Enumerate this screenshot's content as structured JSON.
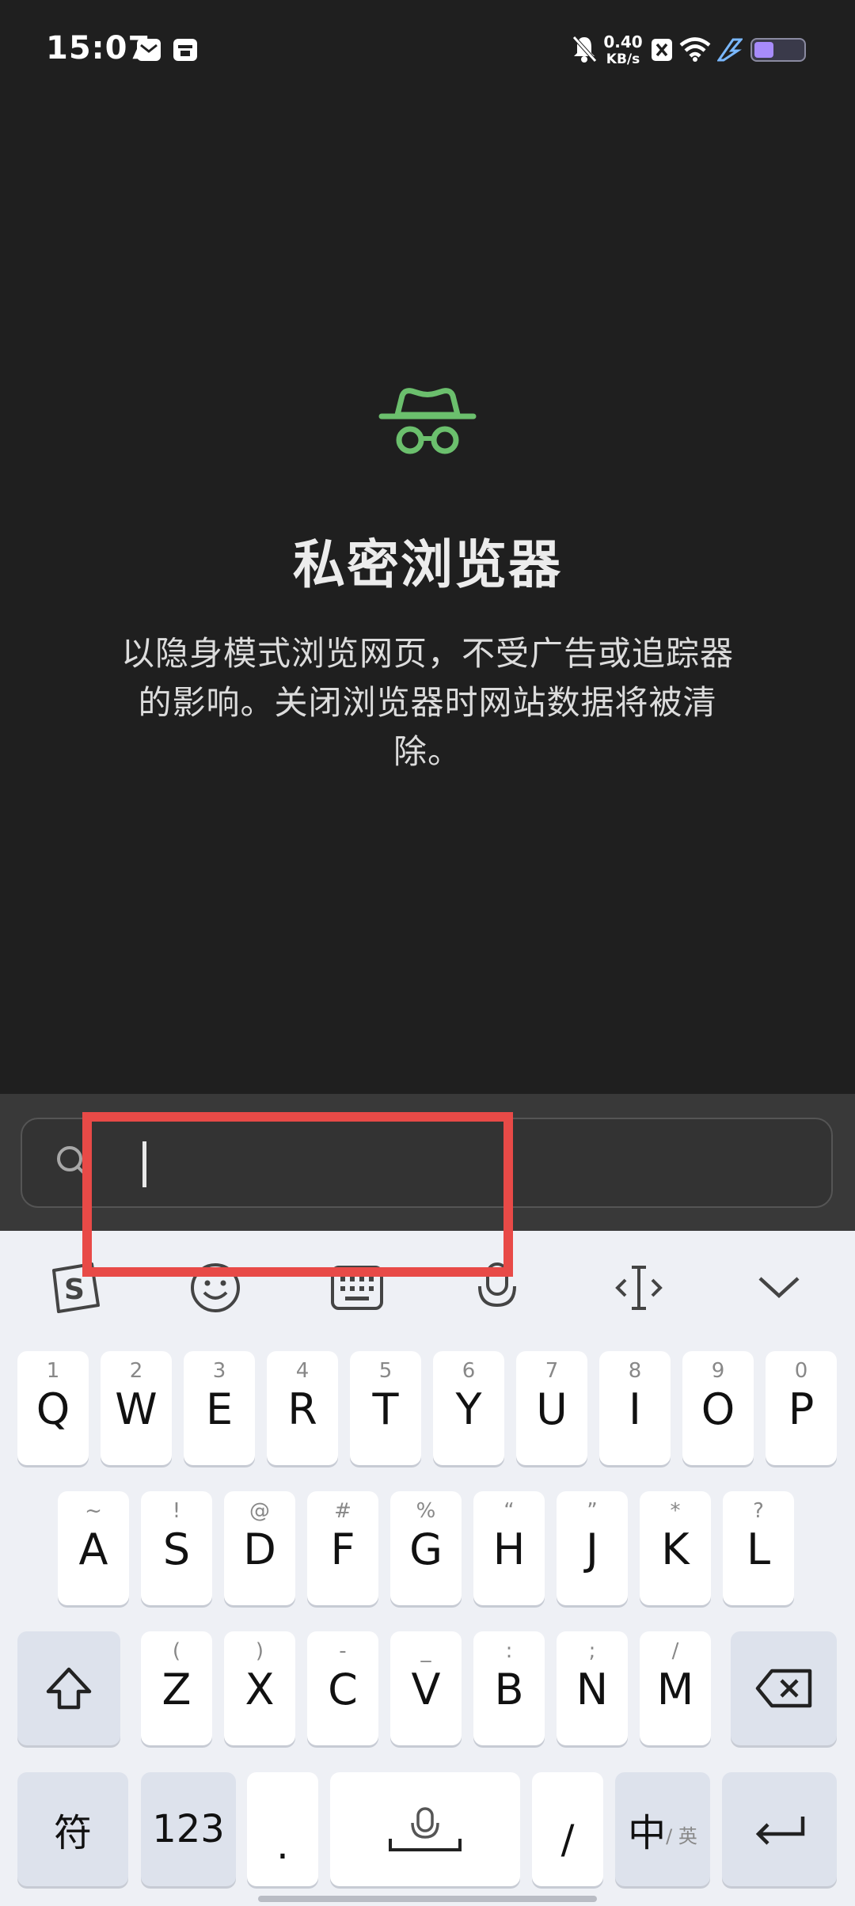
{
  "status_bar": {
    "time": "15:07",
    "net_speed_value": "0.40",
    "net_speed_unit": "KB/s",
    "icons": [
      "mail-icon",
      "calendar-icon",
      "mute-icon",
      "close-box-icon",
      "wifi-icon",
      "charging-icon",
      "battery-icon"
    ]
  },
  "incognito": {
    "icon": "incognito-hat-glasses-icon",
    "icon_color": "#6bbf6d",
    "title": "私密浏览器",
    "description": "以隐身模式浏览网页，不受广告或追踪器的影响。关闭浏览器时网站数据将被清除。"
  },
  "search": {
    "value": "",
    "icon": "search-icon"
  },
  "keyboard": {
    "toolbar": [
      "sogou-logo-icon",
      "emoji-icon",
      "keyboard-icon",
      "microphone-icon",
      "cursor-icon",
      "collapse-icon"
    ],
    "row1": [
      {
        "key": "Q",
        "sub": "1"
      },
      {
        "key": "W",
        "sub": "2"
      },
      {
        "key": "E",
        "sub": "3"
      },
      {
        "key": "R",
        "sub": "4"
      },
      {
        "key": "T",
        "sub": "5"
      },
      {
        "key": "Y",
        "sub": "6"
      },
      {
        "key": "U",
        "sub": "7"
      },
      {
        "key": "I",
        "sub": "8"
      },
      {
        "key": "O",
        "sub": "9"
      },
      {
        "key": "P",
        "sub": "0"
      }
    ],
    "row2": [
      {
        "key": "A",
        "sub": "~"
      },
      {
        "key": "S",
        "sub": "!"
      },
      {
        "key": "D",
        "sub": "@"
      },
      {
        "key": "F",
        "sub": "#"
      },
      {
        "key": "G",
        "sub": "%"
      },
      {
        "key": "H",
        "sub": "“"
      },
      {
        "key": "J",
        "sub": "”"
      },
      {
        "key": "K",
        "sub": "*"
      },
      {
        "key": "L",
        "sub": "?"
      }
    ],
    "row3": [
      {
        "key": "Z",
        "sub": "("
      },
      {
        "key": "X",
        "sub": ")"
      },
      {
        "key": "C",
        "sub": "-"
      },
      {
        "key": "V",
        "sub": "_"
      },
      {
        "key": "B",
        "sub": ":"
      },
      {
        "key": "N",
        "sub": ";"
      },
      {
        "key": "M",
        "sub": "/"
      }
    ],
    "bottom": {
      "symbols": "符",
      "numbers": "123",
      "period": ".",
      "slash": "/",
      "lang_main": "中",
      "lang_sub": "/ 英"
    },
    "accent": "#e84a47"
  }
}
